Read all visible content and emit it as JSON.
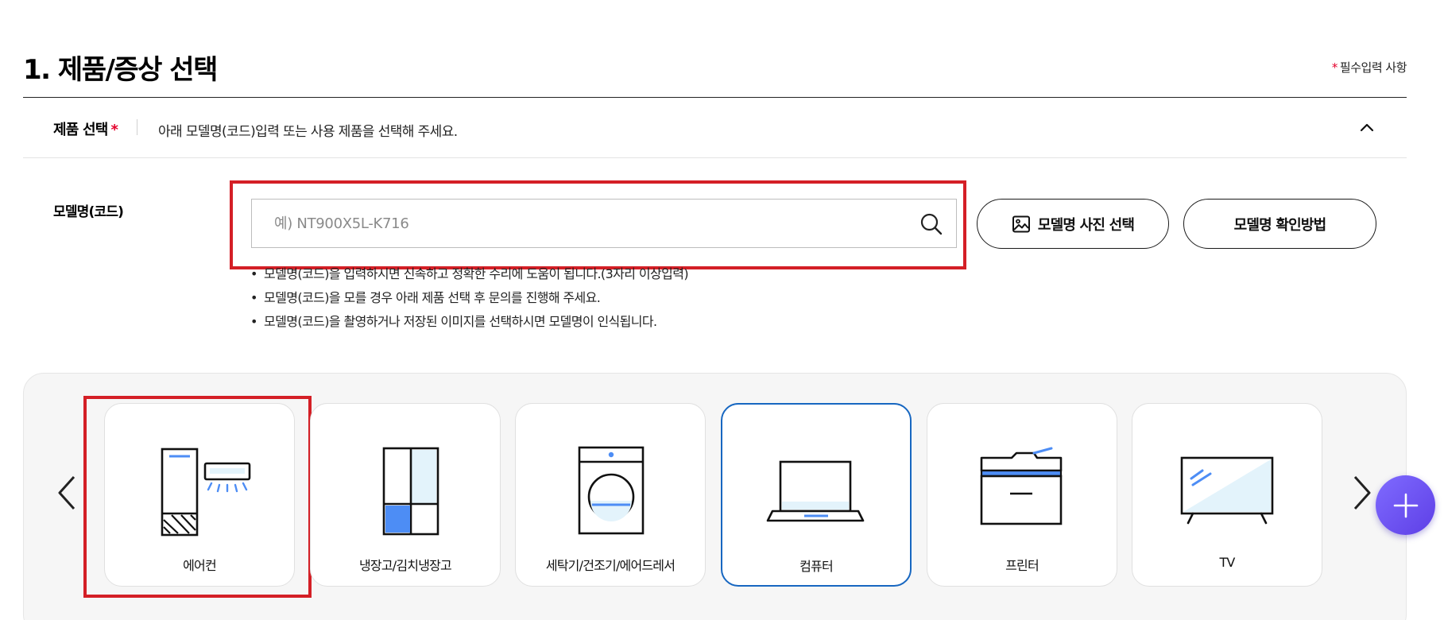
{
  "section": {
    "title": "1. 제품/증상 선택",
    "required_note_star": "*",
    "required_note": "필수입력 사항"
  },
  "product_select": {
    "label": "제품 선택",
    "required_star": "*",
    "description": "아래 모델명(코드)입력 또는 사용 제품을 선택해 주세요.",
    "toggle_icon": "chevron-up-icon"
  },
  "model_input": {
    "label": "모델명(코드)",
    "placeholder": "예) NT900X5L-K716",
    "value": "",
    "search_icon": "search-icon"
  },
  "buttons": {
    "photo_select": "모델명 사진 선택",
    "how_to_check": "모델명 확인방법"
  },
  "guides": [
    "모델명(코드)을 입력하시면 신속하고 정확한 수리에 도움이 됩니다.(3자리 이상입력)",
    "모델명(코드)을 모를 경우 아래 제품 선택 후 문의를 진행해 주세요.",
    "모델명(코드)을 촬영하거나 저장된 이미지를 선택하시면 모델명이 인식됩니다."
  ],
  "categories": [
    {
      "label": "에어컨",
      "icon": "air-conditioner-icon",
      "selected": false
    },
    {
      "label": "냉장고/김치냉장고",
      "icon": "refrigerator-icon",
      "selected": false
    },
    {
      "label": "세탁기/건조기/에어드레서",
      "icon": "washing-machine-icon",
      "selected": false
    },
    {
      "label": "컴퓨터",
      "icon": "laptop-icon",
      "selected": true
    },
    {
      "label": "프린터",
      "icon": "printer-icon",
      "selected": false
    },
    {
      "label": "TV",
      "icon": "tv-icon",
      "selected": false
    }
  ],
  "colors": {
    "accent_red": "#e4002b",
    "highlight_red": "#d41f26",
    "selected_blue": "#1767c1",
    "icon_blue": "#4d8df5",
    "icon_light_blue": "#e3f3fb",
    "fab_purple": "#6a4ff0"
  },
  "fab": {
    "icon": "plus-icon"
  }
}
